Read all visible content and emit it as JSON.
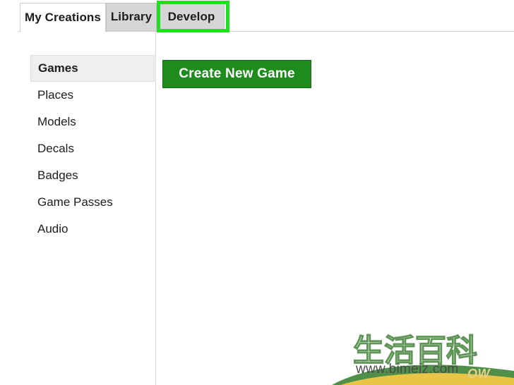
{
  "tabs": [
    {
      "label": "My Creations",
      "state": "active"
    },
    {
      "label": "Library",
      "state": "inactive"
    },
    {
      "label": "Develop",
      "state": "inactive",
      "highlighted": true
    }
  ],
  "sidebar": {
    "items": [
      {
        "label": "Games",
        "selected": true
      },
      {
        "label": "Places",
        "selected": false
      },
      {
        "label": "Models",
        "selected": false
      },
      {
        "label": "Decals",
        "selected": false
      },
      {
        "label": "Badges",
        "selected": false
      },
      {
        "label": "Game Passes",
        "selected": false
      },
      {
        "label": "Audio",
        "selected": false
      }
    ]
  },
  "main": {
    "create_button_label": "Create New Game"
  },
  "watermark": {
    "cjk_text": "生活百科",
    "url": "www.bimeiz.com",
    "ghost_text": "OW"
  },
  "colors": {
    "highlight_green": "#21e021",
    "button_green": "#1d8c1d",
    "button_border_green": "#136d13",
    "tab_inactive_gray": "#d6d6d6",
    "nav_selected_gray": "#efefef",
    "watermark_green": "#5f9457",
    "watermark_yellow": "#e8c547"
  }
}
